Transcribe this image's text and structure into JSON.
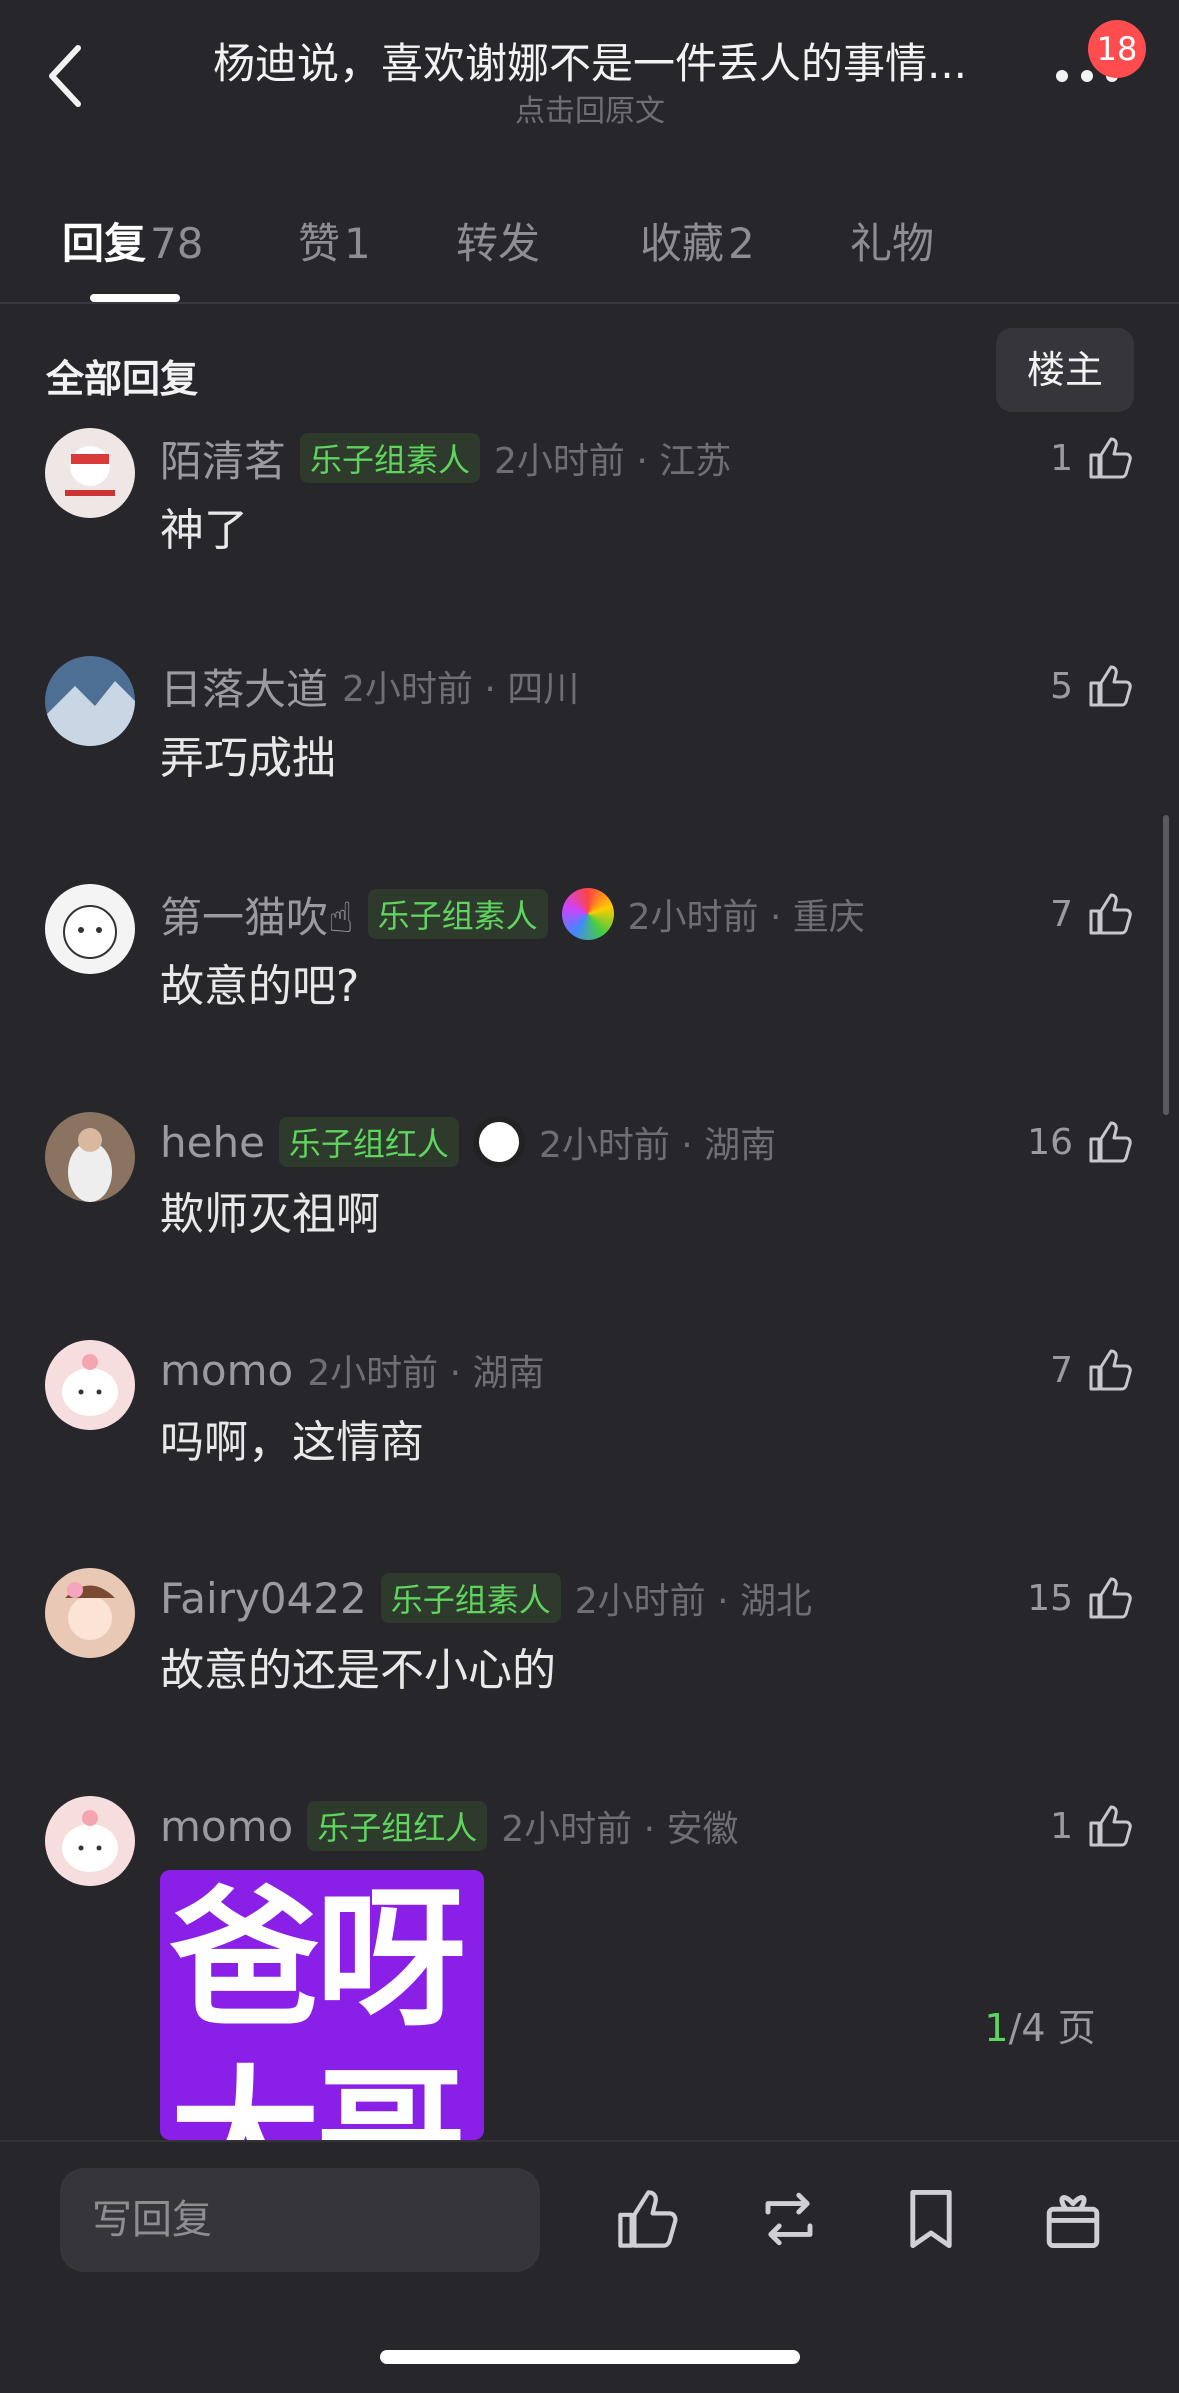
{
  "header": {
    "title": "杨迪说，喜欢谢娜不是一件丢人的事情...",
    "subtitle": "点击回原文",
    "badge": "18"
  },
  "tabs": [
    {
      "label": "回复",
      "count": "78",
      "active": true
    },
    {
      "label": "赞",
      "count": "1"
    },
    {
      "label": "转发",
      "count": ""
    },
    {
      "label": "收藏",
      "count": "2"
    },
    {
      "label": "礼物",
      "count": ""
    }
  ],
  "section": {
    "title": "全部回复",
    "owner_button": "楼主"
  },
  "comments": [
    {
      "user": "陌清茗",
      "tag": "乐子组素人",
      "time": "2小时前 · 江苏",
      "likes": "1",
      "text": "神了",
      "avatar_color": "#e9dede"
    },
    {
      "user": "日落大道",
      "tag": "",
      "time": "2小时前 · 四川",
      "likes": "5",
      "text": "弄巧成拙",
      "avatar_color": "#4d6f93"
    },
    {
      "user": "第一猫吹☝",
      "tag": "乐子组素人",
      "time": "2小时前 · 重庆",
      "likes": "7",
      "text": "故意的吧?",
      "avatar_color": "#f4f4f4"
    },
    {
      "user": "hehe",
      "tag": "乐子组红人",
      "time": "2小时前 · 湖南",
      "likes": "16",
      "text": "欺师灭祖啊",
      "avatar_color": "#8a7360"
    },
    {
      "user": "momo",
      "tag": "",
      "time": "2小时前 · 湖南",
      "likes": "7",
      "text": "吗啊，这情商",
      "avatar_color": "#f6dede"
    },
    {
      "user": "Fairy0422",
      "tag": "乐子组素人",
      "time": "2小时前 · 湖北",
      "likes": "15",
      "text": "故意的还是不小心的",
      "avatar_color": "#e9c9b5"
    },
    {
      "user": "momo",
      "tag": "乐子组红人",
      "time": "2小时前 · 安徽",
      "likes": "1",
      "text": "",
      "avatar_color": "#f6dede"
    }
  ],
  "sticker": {
    "text": "爸呀大哥"
  },
  "page": {
    "current": "1",
    "total": "/4 页"
  },
  "bottom": {
    "reply_placeholder": "写回复"
  }
}
